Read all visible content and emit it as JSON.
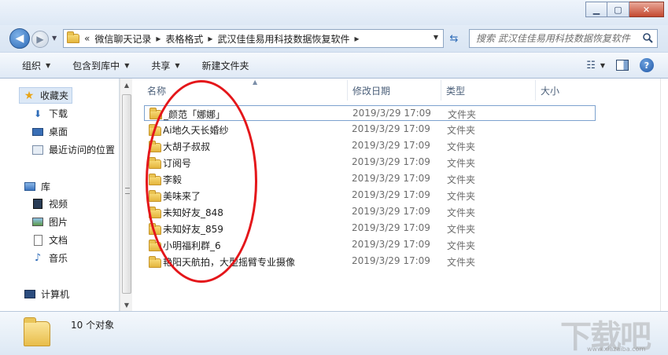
{
  "window": {
    "minimize_label": "▁",
    "maximize_label": "▢",
    "close_label": "✕"
  },
  "address": {
    "overflow_label": "«",
    "breadcrumbs": [
      "微信聊天记录",
      "表格格式",
      "武汉佳佳易用科技数据恢复软件"
    ],
    "separator": "▸"
  },
  "search": {
    "placeholder": "搜索 武汉佳佳易用科技数据恢复软件"
  },
  "toolbar": {
    "organize": "组织",
    "include_in_library": "包含到库中",
    "share": "共享",
    "new_folder": "新建文件夹"
  },
  "nav": {
    "favorites": "收藏夹",
    "downloads": "下载",
    "desktop": "桌面",
    "recent_places": "最近访问的位置",
    "libraries": "库",
    "videos": "视频",
    "pictures": "图片",
    "documents": "文档",
    "music": "音乐",
    "computer": "计算机"
  },
  "columns": {
    "name": "名称",
    "date_modified": "修改日期",
    "type": "类型",
    "size": "大小"
  },
  "files": [
    {
      "name": "_颜范「娜娜」",
      "date": "2019/3/29 17:09",
      "type": "文件夹"
    },
    {
      "name": "Ai地久天长婚纱",
      "date": "2019/3/29 17:09",
      "type": "文件夹"
    },
    {
      "name": "大胡子叔叔",
      "date": "2019/3/29 17:09",
      "type": "文件夹"
    },
    {
      "name": "订阅号",
      "date": "2019/3/29 17:09",
      "type": "文件夹"
    },
    {
      "name": "李毅",
      "date": "2019/3/29 17:09",
      "type": "文件夹"
    },
    {
      "name": "美味来了",
      "date": "2019/3/29 17:09",
      "type": "文件夹"
    },
    {
      "name": "未知好友_848",
      "date": "2019/3/29 17:09",
      "type": "文件夹"
    },
    {
      "name": "未知好友_859",
      "date": "2019/3/29 17:09",
      "type": "文件夹"
    },
    {
      "name": "小明福利群_6",
      "date": "2019/3/29 17:09",
      "type": "文件夹"
    },
    {
      "name": "艳阳天航拍，大型摇臂专业摄像",
      "date": "2019/3/29 17:09",
      "type": "文件夹"
    }
  ],
  "details": {
    "object_count": "10 个对象"
  },
  "watermark": {
    "text": "下载吧",
    "url": "www.xiazaiba.com"
  },
  "colors": {
    "annotation": "#e4161a",
    "accent": "#2d6bb8"
  }
}
